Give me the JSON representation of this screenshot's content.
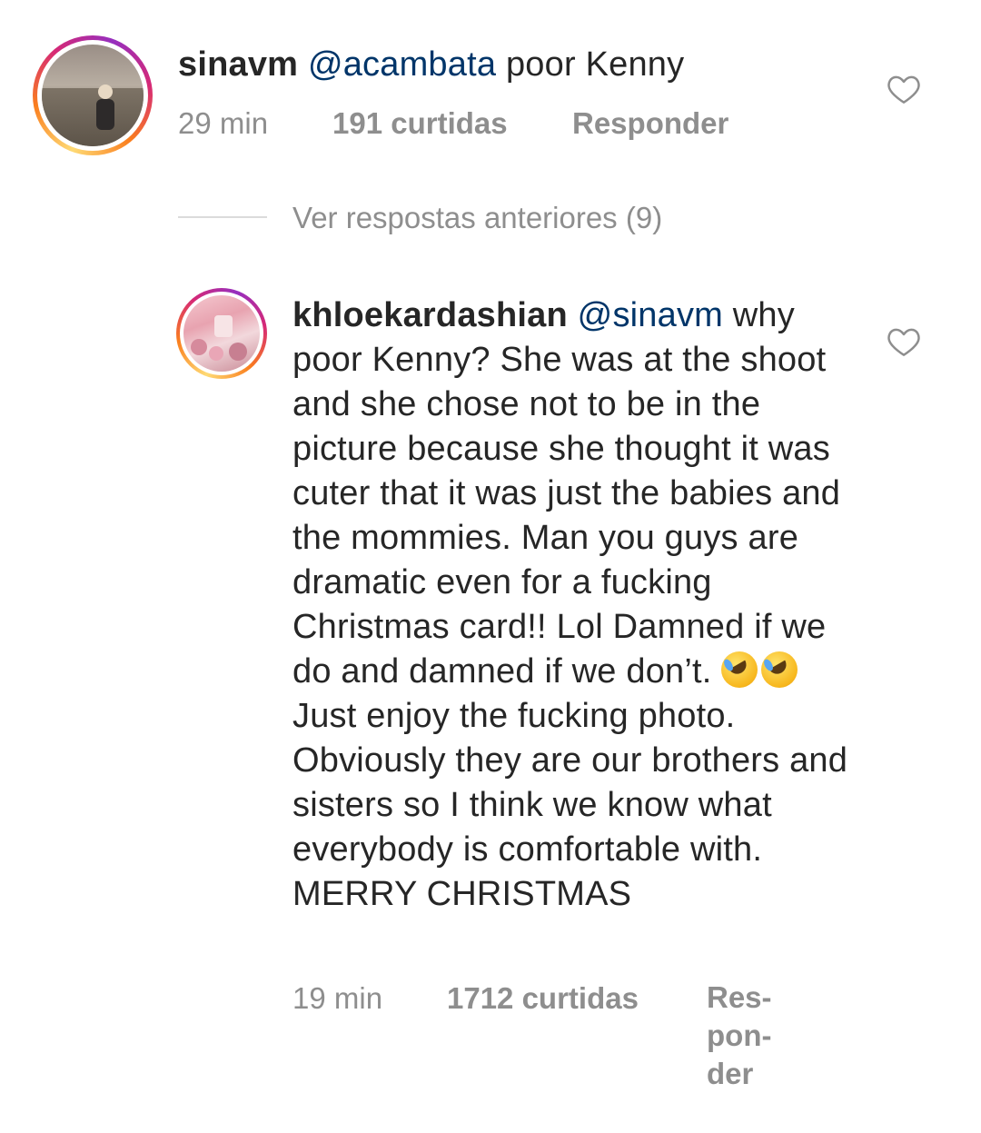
{
  "comment1": {
    "username": "sinavm",
    "mention": "@acambata",
    "text": " poor Kenny",
    "time": "29 min",
    "likes": "191 curtidas",
    "reply": "Responder",
    "avatar_icon": "profile-photo"
  },
  "replies_link": {
    "label": "Ver respostas anteriores (9)"
  },
  "comment2": {
    "username": "khloekardashian",
    "mention": "@sinavm",
    "text_part1": " why poor Kenny? She was at the shoot and she chose not to be in the picture because she thought it was cuter that it was just the babies and the mommies. Man you guys are dramatic even for a fucking Christmas card!! Lol Damned if we do and damned if we don’t. ",
    "emoji": "rolling-on-floor-laughing",
    "text_part2": " Just enjoy the fucking photo. Obviously they are our brothers and sisters so I think we know what everybody is comfortable with. MERRY CHRISTMAS",
    "time": "19 min",
    "likes": "1712 curtidas",
    "reply_lines": [
      "Res-",
      "pon-",
      "der"
    ],
    "avatar_icon": "profile-photo"
  },
  "colors": {
    "text": "#262626",
    "mention": "#003569",
    "meta": "#8e8e8e",
    "divider": "#dbdbdb"
  }
}
